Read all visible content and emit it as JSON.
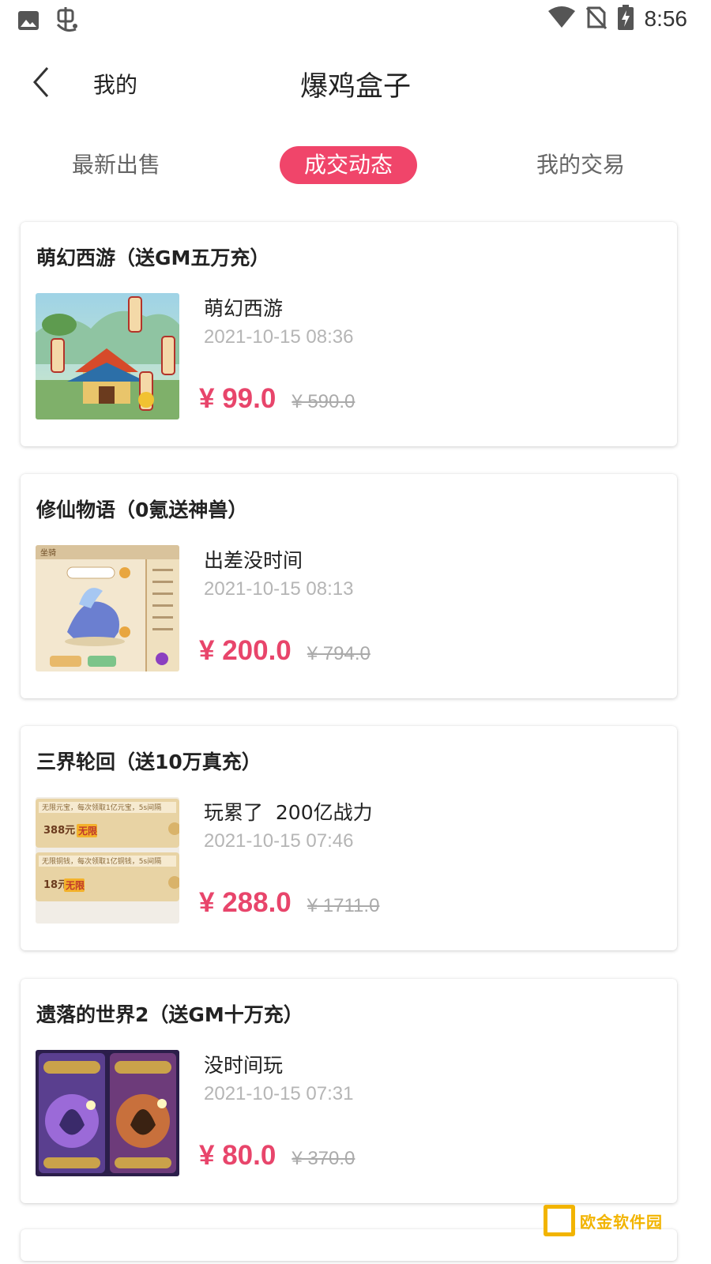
{
  "status_bar": {
    "time": "8:56",
    "icons": [
      "image-icon",
      "bug-icon",
      "wifi-icon",
      "no-sim-icon",
      "battery-charging-icon"
    ]
  },
  "header": {
    "back_label": "我的",
    "title": "爆鸡盒子"
  },
  "tabs": [
    {
      "label": "最新出售",
      "active": false
    },
    {
      "label": "成交动态",
      "active": true
    },
    {
      "label": "我的交易",
      "active": false
    }
  ],
  "deals": [
    {
      "game": "萌幻西游（送GM五万充）",
      "seller": "萌幻西游",
      "time": "2021-10-15 08:36",
      "price": "¥ 99.0",
      "original_price": "¥ 590.0"
    },
    {
      "game": "修仙物语（0氪送神兽）",
      "seller": "出差没时间",
      "time": "2021-10-15 08:13",
      "price": "¥ 200.0",
      "original_price": "¥ 794.0"
    },
    {
      "game": "三界轮回（送10万真充）",
      "seller": "玩累了  200亿战力",
      "time": "2021-10-15 07:46",
      "price": "¥ 288.0",
      "original_price": "¥ 1711.0"
    },
    {
      "game": "遗落的世界2（送GM十万充）",
      "seller": "没时间玩",
      "time": "2021-10-15 07:31",
      "price": "¥ 80.0",
      "original_price": "¥ 370.0"
    }
  ],
  "thumbnails": {
    "t3_line1": "无限元宝，每次领取1亿元宝，5s间隔",
    "t3_price1": "388元",
    "t3_badge1": "无限",
    "t3_line2": "无限铜钱，每次领取1亿铜钱，5s间隔",
    "t3_price2": "18元",
    "t3_badge2": "无限",
    "t2_header": "坐骑"
  },
  "watermark": "欧金软件园",
  "colors": {
    "accent": "#f0456a",
    "price": "#e8456b",
    "muted": "#b5b5b5",
    "watermark": "#f2b400"
  }
}
